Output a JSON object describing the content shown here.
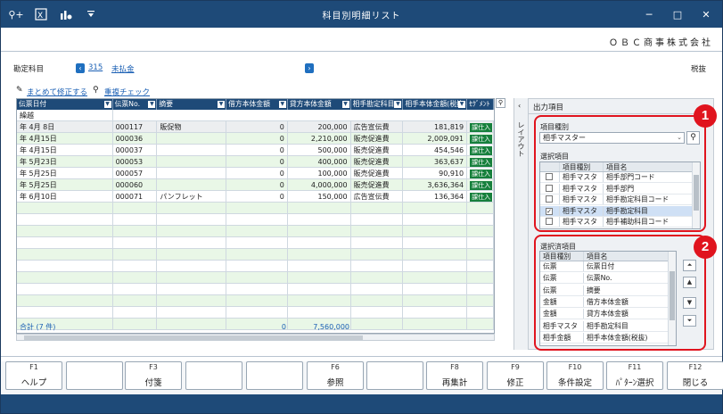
{
  "window": {
    "title": "科目別明細リスト",
    "company": "ＯＢＣ商事株式会社"
  },
  "toolbar": {
    "icons": [
      "key-search-icon",
      "excel-icon",
      "chart-icon",
      "dropdown-icon"
    ]
  },
  "account": {
    "label": "勘定科目",
    "code": "315",
    "name": "未払金",
    "tax": "税抜"
  },
  "links": {
    "bulk_edit": "まとめて修正する",
    "dup_check": "重複チェック"
  },
  "grid": {
    "columns": [
      "伝票日付",
      "伝票No.",
      "摘要",
      "借方本体金額",
      "貸方本体金額",
      "相手勘定科目",
      "相手本体金額(税抜)",
      "ｾｸﾞﾒﾝﾄ"
    ],
    "carry": "繰越",
    "rows": [
      {
        "date": "年 4月 8日",
        "no": "000117",
        "memo": "販促物",
        "debit": "0",
        "credit": "200,000",
        "counter": "広告宣伝費",
        "amount": "181,819",
        "tag": "課仕入"
      },
      {
        "date": "年 4月15日",
        "no": "000036",
        "memo": "",
        "debit": "0",
        "credit": "2,210,000",
        "counter": "販売促進費",
        "amount": "2,009,091",
        "tag": "課仕入"
      },
      {
        "date": "年 4月15日",
        "no": "000037",
        "memo": "",
        "debit": "0",
        "credit": "500,000",
        "counter": "販売促進費",
        "amount": "454,546",
        "tag": "課仕入"
      },
      {
        "date": "年 5月23日",
        "no": "000053",
        "memo": "",
        "debit": "0",
        "credit": "400,000",
        "counter": "販売促進費",
        "amount": "363,637",
        "tag": "課仕入"
      },
      {
        "date": "年 5月25日",
        "no": "000057",
        "memo": "",
        "debit": "0",
        "credit": "100,000",
        "counter": "販売促進費",
        "amount": "90,910",
        "tag": "課仕入"
      },
      {
        "date": "年 5月25日",
        "no": "000060",
        "memo": "",
        "debit": "0",
        "credit": "4,000,000",
        "counter": "販売促進費",
        "amount": "3,636,364",
        "tag": "課仕入"
      },
      {
        "date": "年 6月10日",
        "no": "000071",
        "memo": "パンフレット",
        "debit": "0",
        "credit": "150,000",
        "counter": "広告宣伝費",
        "amount": "136,364",
        "tag": "課仕入"
      }
    ],
    "total_label": "合計 (7 件)",
    "total_debit": "0",
    "total_credit": "7,560,000"
  },
  "panel": {
    "strip_label": "レイアウト",
    "title": "出力項目",
    "item_type_label": "項目種別",
    "item_type_value": "相手マスター",
    "select_label": "選択項目",
    "select_columns": [
      "項目種別",
      "項目名"
    ],
    "select_rows": [
      {
        "type": "相手マスタ",
        "name": "相手部門コード",
        "checked": ""
      },
      {
        "type": "相手マスタ",
        "name": "相手部門",
        "checked": ""
      },
      {
        "type": "相手マスタ",
        "name": "相手勘定科目コード",
        "checked": ""
      },
      {
        "type": "相手マスタ",
        "name": "相手勘定科目",
        "checked": "✓"
      },
      {
        "type": "相手マスタ",
        "name": "相手補助科目コード",
        "checked": ""
      }
    ],
    "selected_label": "選択済項目",
    "selected_columns": [
      "項目種別",
      "項目名"
    ],
    "selected_rows": [
      {
        "type": "伝票",
        "name": "伝票日付"
      },
      {
        "type": "伝票",
        "name": "伝票No."
      },
      {
        "type": "伝票",
        "name": "摘要"
      },
      {
        "type": "金額",
        "name": "借方本体金額"
      },
      {
        "type": "金額",
        "name": "貸方本体金額"
      },
      {
        "type": "相手マスタ",
        "name": "相手勘定科目"
      },
      {
        "type": "相手金額",
        "name": "相手本体金額(税抜)"
      }
    ]
  },
  "callouts": [
    "1",
    "2"
  ],
  "fkeys": [
    {
      "key": "F1",
      "label": "ヘルプ"
    },
    {
      "key": "",
      "label": ""
    },
    {
      "key": "F3",
      "label": "付箋"
    },
    {
      "key": "",
      "label": ""
    },
    {
      "key": "",
      "label": ""
    },
    {
      "key": "F6",
      "label": "参照"
    },
    {
      "key": "",
      "label": ""
    },
    {
      "key": "F8",
      "label": "再集計"
    },
    {
      "key": "F9",
      "label": "修正"
    },
    {
      "key": "F10",
      "label": "条件設定"
    },
    {
      "key": "F11",
      "label": "ﾊﾟﾀｰﾝ選択"
    },
    {
      "key": "F12",
      "label": "閉じる"
    }
  ]
}
